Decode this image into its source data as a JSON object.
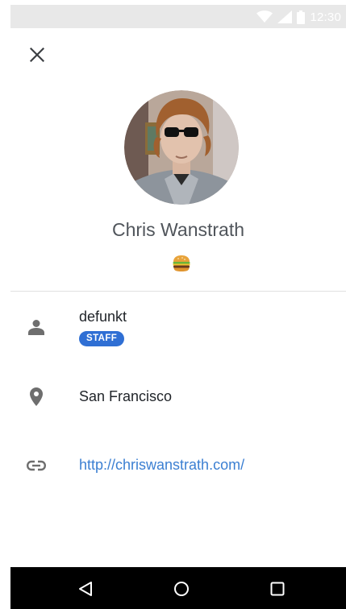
{
  "status_bar": {
    "time": "12:30",
    "icons": [
      "wifi-icon",
      "signal-icon",
      "battery-icon"
    ]
  },
  "header": {
    "close_icon": "close-icon"
  },
  "profile": {
    "name": "Chris Wanstrath",
    "status_emoji": "hamburger-emoji"
  },
  "details": {
    "username": "defunkt",
    "badge": "STAFF",
    "location": "San Francisco",
    "website": "http://chriswanstrath.com/"
  },
  "nav_bar": {
    "buttons": [
      "back-icon",
      "home-icon",
      "recents-icon"
    ]
  },
  "colors": {
    "status_bar_bg": "#e8e8e8",
    "name_text": "#50555b",
    "badge_bg": "#2f6fd4",
    "link": "#3b7fd2",
    "icon_gray": "#6e6e6e",
    "nav_bar_bg": "#000000"
  }
}
